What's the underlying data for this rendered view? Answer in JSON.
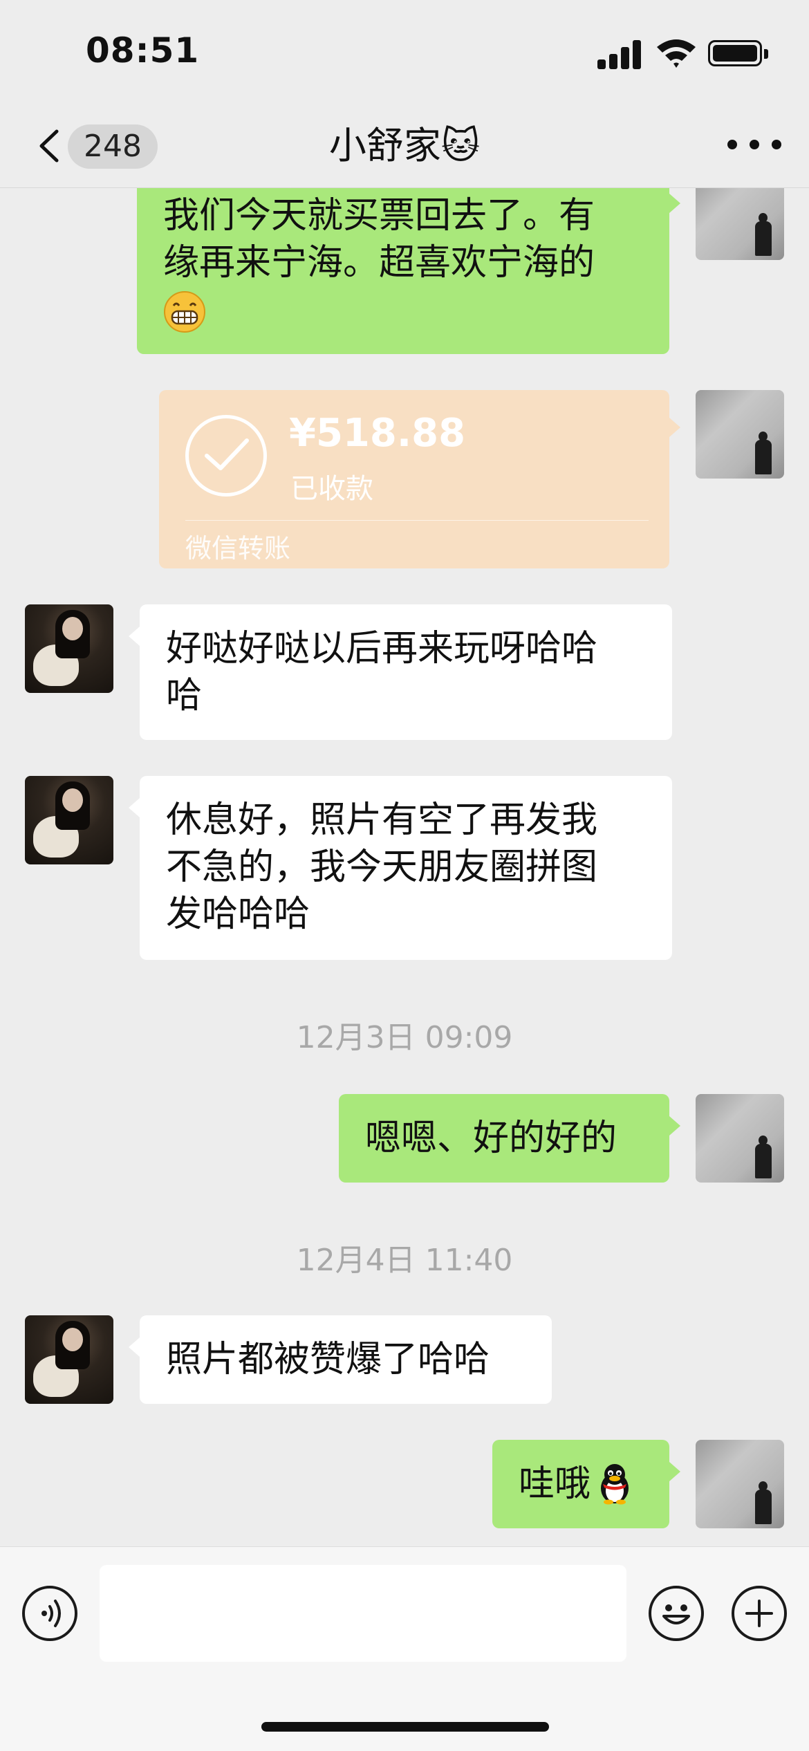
{
  "status_bar": {
    "time": "08:51"
  },
  "nav": {
    "unread_count": "248",
    "title": "小舒家🐱"
  },
  "messages": [
    {
      "from": "me",
      "text_line1": "我们今天就买票回去了。有",
      "text_line2": "缘再来宁海。超喜欢宁海的",
      "emoji": "grinning-face-emoji"
    },
    {
      "from": "me",
      "type": "transfer",
      "amount": "¥518.88",
      "status": "已收款",
      "label": "微信转账"
    },
    {
      "from": "her",
      "text_line1": "好哒好哒以后再来玩呀哈哈",
      "text_line2": "哈"
    },
    {
      "from": "her",
      "text_line1": "休息好，照片有空了再发我",
      "text_line2": "不急的，我今天朋友圈拼图",
      "text_line3": "发哈哈哈"
    },
    {
      "type": "timestamp",
      "text": "12月3日 09:09"
    },
    {
      "from": "me",
      "text": "嗯嗯、好的好的"
    },
    {
      "type": "timestamp",
      "text": "12月4日 11:40"
    },
    {
      "from": "her",
      "text": "照片都被赞爆了哈哈"
    },
    {
      "from": "me",
      "text": "哇哦",
      "emoji": "penguin-emoji"
    }
  ],
  "input": {
    "value": "",
    "placeholder": ""
  },
  "icons": [
    "back-chevron-icon",
    "more-icon",
    "voice-icon",
    "emoji-icon",
    "plus-icon",
    "signal-icon",
    "wifi-icon",
    "battery-icon"
  ],
  "colors": {
    "background": "#ededed",
    "my_bubble": "#a9e87b",
    "their_bubble": "#ffffff",
    "transfer_card": "#f8dfc3",
    "timestamp": "#a8a8a8"
  }
}
